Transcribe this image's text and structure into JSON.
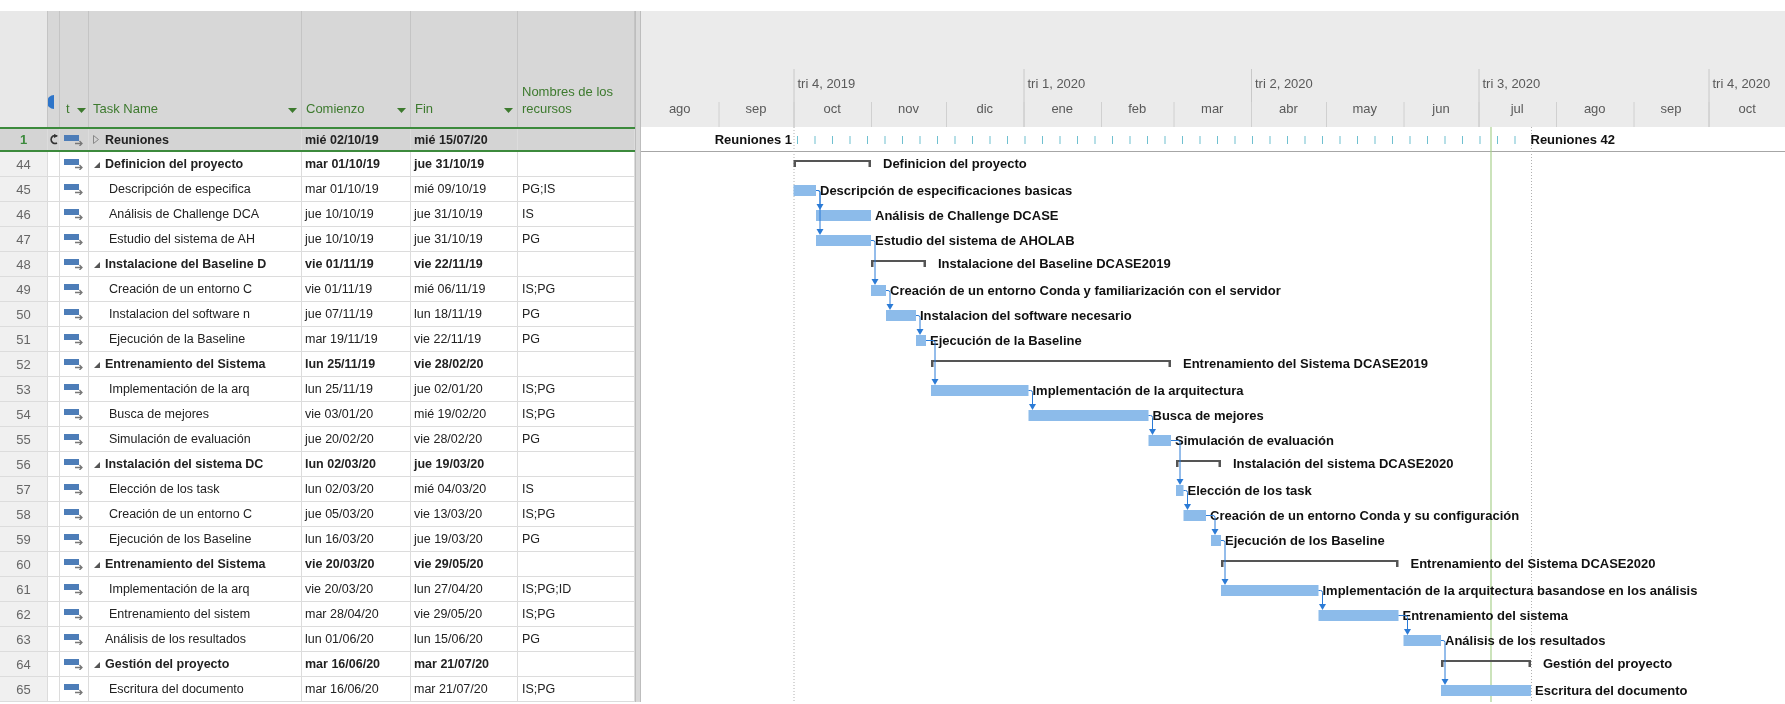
{
  "timescale": {
    "quarters": [
      "tri 4, 2019",
      "tri 1, 2020",
      "tri 2, 2020",
      "tri 3, 2020",
      "tri 4, 2020"
    ],
    "months": [
      "ago",
      "sep",
      "oct",
      "nov",
      "dic",
      "ene",
      "feb",
      "mar",
      "abr",
      "may",
      "jun",
      "jul",
      "ago",
      "sep",
      "oct"
    ]
  },
  "columns": [
    {
      "kind": "mode",
      "label": "t",
      "dropdown": true
    },
    {
      "kind": "name",
      "label": "Task Name",
      "dropdown": true
    },
    {
      "kind": "start",
      "label": "Comienzo",
      "dropdown": true
    },
    {
      "kind": "finish",
      "label": "Fin",
      "dropdown": true
    },
    {
      "kind": "resources",
      "label": "Nombres de los recursos",
      "dropdown": false
    }
  ],
  "tasks": [
    {
      "row": "1",
      "kind": "recurring",
      "name": "Reuniones",
      "start": "mié 02/10/19",
      "finish": "mié 15/07/20",
      "selected": true,
      "expanded": false,
      "first_label": "Reuniones 1",
      "last_label": "Reuniones 42"
    },
    {
      "row": "44",
      "kind": "summary",
      "name": "Definicion del proyecto",
      "start": "mar 01/10/19",
      "finish": "jue 31/10/19",
      "selected": false,
      "expanded": true,
      "bar_label": "Definicion del proyecto",
      "children": [
        {
          "row": "45",
          "kind": "task",
          "name": "Descripción de especifica",
          "start": "mar 01/10/19",
          "finish": "mié 09/10/19",
          "resources": "PG;IS",
          "selected": false,
          "bar_label": "Descripción de especificaciones basicas"
        },
        {
          "row": "46",
          "kind": "task",
          "name": "Análisis de Challenge DCA",
          "start": "jue 10/10/19",
          "finish": "jue 31/10/19",
          "resources": "IS",
          "selected": false,
          "bar_label": "Análisis de Challenge DCASE"
        },
        {
          "row": "47",
          "kind": "task",
          "name": "Estudio del sistema de AH",
          "start": "jue 10/10/19",
          "finish": "jue 31/10/19",
          "resources": "PG",
          "selected": false,
          "bar_label": "Estudio del sistema de AHOLAB"
        }
      ]
    },
    {
      "row": "48",
      "kind": "summary",
      "name": "Instalacione del Baseline D",
      "start": "vie 01/11/19",
      "finish": "vie 22/11/19",
      "selected": false,
      "expanded": true,
      "bar_label": "Instalacione del Baseline DCASE2019",
      "children": [
        {
          "row": "49",
          "kind": "task",
          "name": "Creación de un entorno C",
          "start": "vie 01/11/19",
          "finish": "mié 06/11/19",
          "resources": "IS;PG",
          "selected": false,
          "bar_label": "Creación de un entorno Conda y familiarización con el servidor"
        },
        {
          "row": "50",
          "kind": "task",
          "name": "Instalacion del software n",
          "start": "jue 07/11/19",
          "finish": "lun 18/11/19",
          "resources": "PG",
          "selected": false,
          "bar_label": "Instalacion del software necesario"
        },
        {
          "row": "51",
          "kind": "task",
          "name": "Ejecución de la Baseline",
          "start": "mar 19/11/19",
          "finish": "vie 22/11/19",
          "resources": "PG",
          "selected": false,
          "bar_label": "Ejecución de la Baseline"
        }
      ]
    },
    {
      "row": "52",
      "kind": "summary",
      "name": "Entrenamiento del Sistema",
      "start": "lun 25/11/19",
      "finish": "vie 28/02/20",
      "selected": false,
      "expanded": true,
      "bar_label": "Entrenamiento del Sistema DCASE2019",
      "children": [
        {
          "row": "53",
          "kind": "task",
          "name": "Implementación de la arq",
          "start": "lun 25/11/19",
          "finish": "jue 02/01/20",
          "resources": "IS;PG",
          "selected": false,
          "bar_label": "Implementación de la arquitectura"
        },
        {
          "row": "54",
          "kind": "task",
          "name": "Busca de mejores",
          "start": "vie 03/01/20",
          "finish": "mié 19/02/20",
          "resources": "IS;PG",
          "selected": false,
          "bar_label": "Busca de mejores"
        },
        {
          "row": "55",
          "kind": "task",
          "name": "Simulación de evaluación",
          "start": "jue 20/02/20",
          "finish": "vie 28/02/20",
          "resources": "PG",
          "selected": false,
          "bar_label": "Simulación de evaluación"
        }
      ]
    },
    {
      "row": "56",
      "kind": "summary",
      "name": "Instalación del sistema DC",
      "start": "lun 02/03/20",
      "finish": "jue 19/03/20",
      "selected": false,
      "expanded": true,
      "bar_label": "Instalación del sistema DCASE2020",
      "children": [
        {
          "row": "57",
          "kind": "task",
          "name": "Elección de los task",
          "start": "lun 02/03/20",
          "finish": "mié 04/03/20",
          "resources": "IS",
          "selected": false,
          "bar_label": "Elección de los task"
        },
        {
          "row": "58",
          "kind": "task",
          "name": "Creación de un entorno C",
          "start": "jue 05/03/20",
          "finish": "vie 13/03/20",
          "resources": "IS;PG",
          "selected": false,
          "bar_label": "Creación de un entorno Conda y su configuración"
        },
        {
          "row": "59",
          "kind": "task",
          "name": "Ejecución de los Baseline",
          "start": "lun 16/03/20",
          "finish": "jue 19/03/20",
          "resources": "PG",
          "selected": false,
          "bar_label": "Ejecución de los Baseline"
        }
      ]
    },
    {
      "row": "60",
      "kind": "summary",
      "name": "Entrenamiento del Sistema",
      "start": "vie 20/03/20",
      "finish": "vie 29/05/20",
      "selected": false,
      "expanded": true,
      "bar_label": "Entrenamiento del Sistema DCASE2020",
      "children": [
        {
          "row": "61",
          "kind": "task",
          "name": "Implementación de la arq",
          "start": "vie 20/03/20",
          "finish": "lun 27/04/20",
          "resources": "IS;PG;ID",
          "selected": false,
          "bar_label": "Implementación de la arquitectura basandose en los análisis"
        },
        {
          "row": "62",
          "kind": "task",
          "name": "Entrenamiento del sistem",
          "start": "mar 28/04/20",
          "finish": "vie 29/05/20",
          "resources": "IS;PG",
          "selected": false,
          "bar_label": "Entrenamiento del sistema"
        }
      ]
    },
    {
      "row": "63",
      "kind": "task",
      "name": "Análisis de los resultados",
      "start": "lun 01/06/20",
      "finish": "lun 15/06/20",
      "resources": "PG",
      "selected": false,
      "bar_label": "Análisis de los resultados"
    },
    {
      "row": "64",
      "kind": "summary",
      "name": "Gestión del proyecto",
      "start": "mar 16/06/20",
      "finish": "mar 21/07/20",
      "selected": false,
      "expanded": true,
      "bar_label": "Gestión del proyecto",
      "children": [
        {
          "row": "65",
          "kind": "task",
          "name": "Escritura del documento",
          "start": "mar 16/06/20",
          "finish": "mar 21/07/20",
          "resources": "IS;PG",
          "selected": false,
          "bar_label": "Escritura del documento"
        }
      ]
    }
  ]
}
